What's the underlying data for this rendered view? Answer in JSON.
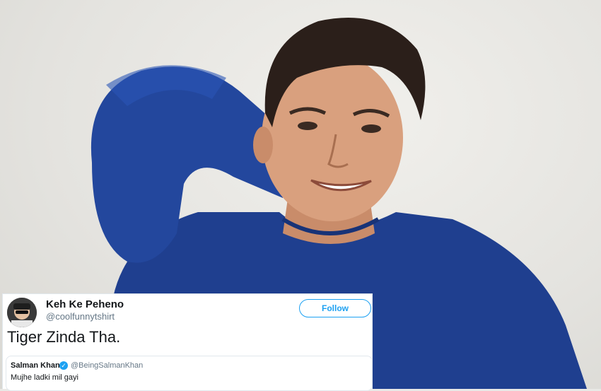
{
  "tweet": {
    "author_name": "Keh Ke Peheno",
    "author_handle": "@coolfunnytshirt",
    "follow_label": "Follow",
    "text": "Tiger Zinda Tha.",
    "quoted": {
      "name": "Salman Khan",
      "verified_icon": "verified-badge-icon",
      "handle": "@BeingSalmanKhan",
      "text": "Mujhe ladki mil gayi"
    }
  },
  "colors": {
    "twitter_blue": "#1da1f2",
    "shirt_blue": "#1f3f8f",
    "background": "#e9e9e6"
  }
}
